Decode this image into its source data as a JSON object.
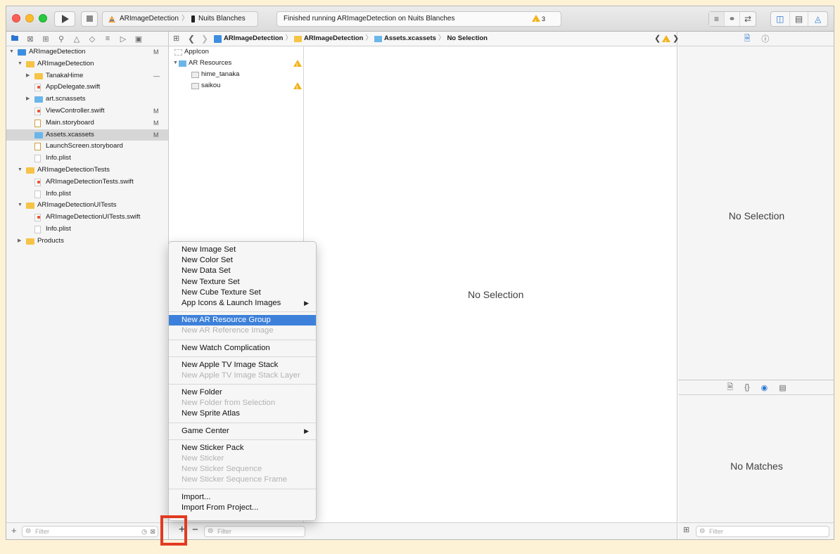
{
  "colors": {
    "accent": "#3d80da",
    "warning": "#f1b41b",
    "highlight_box": "#e23a22",
    "folder": "#f5c447"
  },
  "toolbar": {
    "scheme_target": "ARImageDetection",
    "scheme_device": "Nuits Blanches",
    "activity_text": "Finished running ARImageDetection on Nuits Blanches",
    "warning_count": "3"
  },
  "navigator": {
    "tree": [
      {
        "label": "ARImageDetection",
        "status": "M",
        "indent": 0,
        "icon": "project",
        "disclosure": "open"
      },
      {
        "label": "ARImageDetection",
        "status": "",
        "indent": 1,
        "icon": "folder",
        "disclosure": "open"
      },
      {
        "label": "TanakaHime",
        "status": "—",
        "indent": 2,
        "icon": "folder",
        "disclosure": "closed"
      },
      {
        "label": "AppDelegate.swift",
        "status": "",
        "indent": 2,
        "icon": "swift",
        "disclosure": ""
      },
      {
        "label": "art.scnassets",
        "status": "",
        "indent": 2,
        "icon": "folder-blue",
        "disclosure": "closed"
      },
      {
        "label": "ViewController.swift",
        "status": "M",
        "indent": 2,
        "icon": "swift",
        "disclosure": ""
      },
      {
        "label": "Main.storyboard",
        "status": "M",
        "indent": 2,
        "icon": "storyboard",
        "disclosure": ""
      },
      {
        "label": "Assets.xcassets",
        "status": "M",
        "indent": 2,
        "icon": "folder-blue",
        "disclosure": "",
        "selected": true
      },
      {
        "label": "LaunchScreen.storyboard",
        "status": "",
        "indent": 2,
        "icon": "storyboard",
        "disclosure": ""
      },
      {
        "label": "Info.plist",
        "status": "",
        "indent": 2,
        "icon": "plist",
        "disclosure": ""
      },
      {
        "label": "ARImageDetectionTests",
        "status": "",
        "indent": 1,
        "icon": "folder",
        "disclosure": "open"
      },
      {
        "label": "ARImageDetectionTests.swift",
        "status": "",
        "indent": 2,
        "icon": "swift",
        "disclosure": ""
      },
      {
        "label": "Info.plist",
        "status": "",
        "indent": 2,
        "icon": "plist",
        "disclosure": ""
      },
      {
        "label": "ARImageDetectionUITests",
        "status": "",
        "indent": 1,
        "icon": "folder",
        "disclosure": "open"
      },
      {
        "label": "ARImageDetectionUITests.swift",
        "status": "",
        "indent": 2,
        "icon": "swift",
        "disclosure": ""
      },
      {
        "label": "Info.plist",
        "status": "",
        "indent": 2,
        "icon": "plist",
        "disclosure": ""
      },
      {
        "label": "Products",
        "status": "",
        "indent": 1,
        "icon": "folder",
        "disclosure": "closed"
      }
    ],
    "filter_placeholder": "Filter"
  },
  "editor": {
    "breadcrumb": [
      "ARImageDetection",
      "ARImageDetection",
      "Assets.xcassets",
      "No Selection"
    ],
    "assets": [
      {
        "label": "AppIcon",
        "warning": false
      },
      {
        "label": "AR Resources",
        "warning": true
      },
      {
        "label": "hime_tanaka",
        "warning": false
      },
      {
        "label": "saikou",
        "warning": true
      }
    ],
    "no_selection": "No Selection",
    "filter_placeholder": "Filter"
  },
  "inspector": {
    "no_selection": "No Selection",
    "no_matches": "No Matches",
    "filter_placeholder": "Filter"
  },
  "context_menu": {
    "groups": [
      [
        {
          "label": "New Image Set"
        },
        {
          "label": "New Color Set"
        },
        {
          "label": "New Data Set"
        },
        {
          "label": "New Texture Set"
        },
        {
          "label": "New Cube Texture Set"
        },
        {
          "label": "App Icons & Launch Images",
          "submenu": true
        }
      ],
      [
        {
          "label": "New AR Resource Group",
          "highlighted": true
        },
        {
          "label": "New AR Reference Image",
          "disabled": true
        }
      ],
      [
        {
          "label": "New Watch Complication"
        }
      ],
      [
        {
          "label": "New Apple TV Image Stack"
        },
        {
          "label": "New Apple TV Image Stack Layer",
          "disabled": true
        }
      ],
      [
        {
          "label": "New Folder"
        },
        {
          "label": "New Folder from Selection",
          "disabled": true
        },
        {
          "label": "New Sprite Atlas"
        }
      ],
      [
        {
          "label": "Game Center",
          "submenu": true
        }
      ],
      [
        {
          "label": "New Sticker Pack"
        },
        {
          "label": "New Sticker",
          "disabled": true
        },
        {
          "label": "New Sticker Sequence",
          "disabled": true
        },
        {
          "label": "New Sticker Sequence Frame",
          "disabled": true
        }
      ],
      [
        {
          "label": "Import..."
        },
        {
          "label": "Import From Project..."
        }
      ]
    ]
  },
  "bottom": {
    "add_symbol": "+",
    "remove_symbol": "−"
  }
}
